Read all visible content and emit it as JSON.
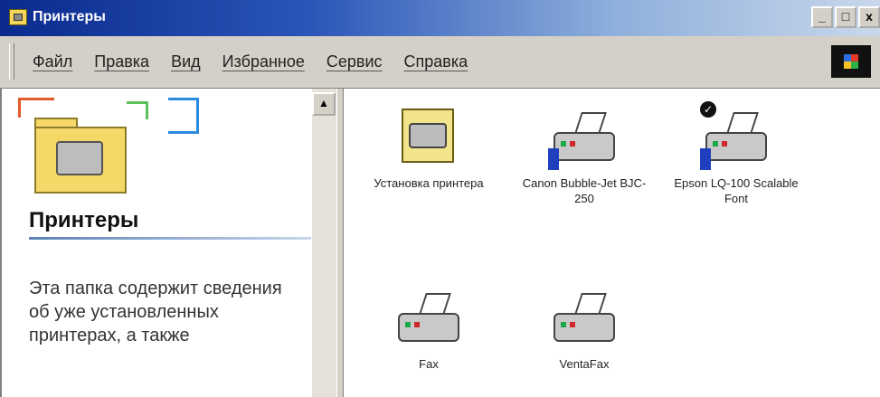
{
  "window": {
    "title": "Принтеры",
    "controls": [
      "_",
      "□",
      "x"
    ]
  },
  "menu": [
    "Файл",
    "Правка",
    "Вид",
    "Избранное",
    "Сервис",
    "Справка"
  ],
  "left_panel": {
    "heading": "Принтеры",
    "description": "Эта папка содержит сведения об уже установленных принтерах, а также"
  },
  "items": [
    {
      "label": "Установка принтера",
      "icon": "install-printer-icon"
    },
    {
      "label": "Canon Bubble-Jet BJC-250",
      "icon": "printer-icon"
    },
    {
      "label": "Epson LQ-100 Scalable Font",
      "icon": "printer-icon",
      "default": true
    },
    {
      "label": "Fax",
      "icon": "fax-printer-icon"
    },
    {
      "label": "VentaFax",
      "icon": "fax-printer-icon"
    }
  ]
}
